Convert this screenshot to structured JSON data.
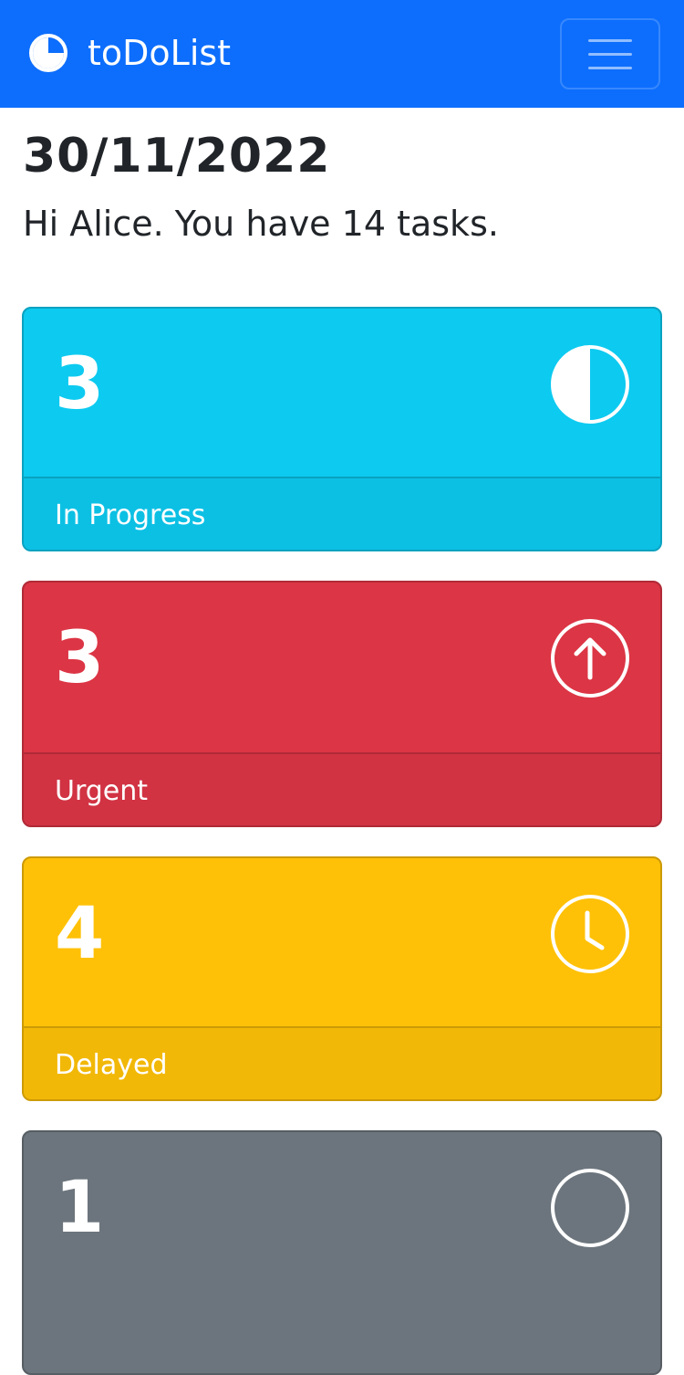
{
  "navbar": {
    "brand": "toDoList",
    "brand_icon": "pie-chart-icon",
    "toggle_icon": "hamburger-menu-icon",
    "color": "#0d6efd"
  },
  "page": {
    "date": "30/11/2022",
    "greeting": "Hi Alice. You have 14 tasks."
  },
  "cards": [
    {
      "count": "3",
      "label": "In Progress",
      "icon": "half-circle-icon",
      "color": "#0dcaf0"
    },
    {
      "count": "3",
      "label": "Urgent",
      "icon": "arrow-up-circle-icon",
      "color": "#dc3545"
    },
    {
      "count": "4",
      "label": "Delayed",
      "icon": "clock-icon",
      "color": "#ffc107"
    },
    {
      "count": "1",
      "label": "",
      "icon": "circle-icon",
      "color": "#6c757d"
    }
  ]
}
